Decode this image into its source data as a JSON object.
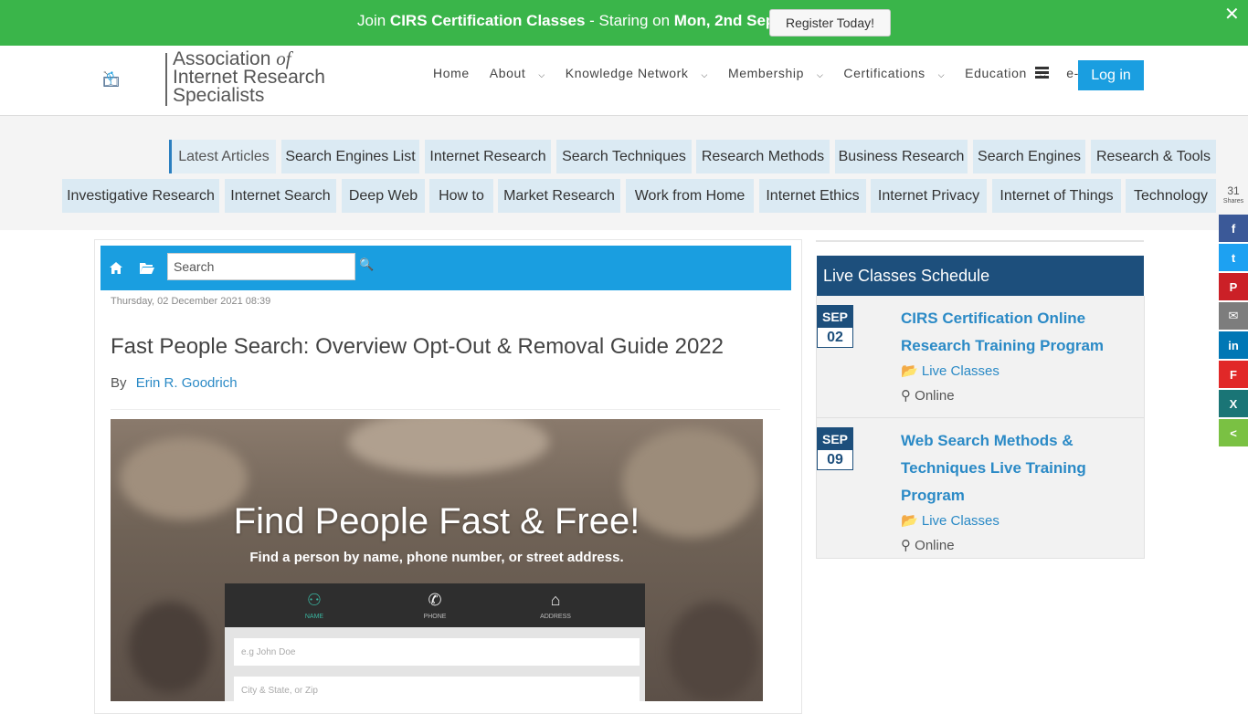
{
  "promo": {
    "prefix": "Join",
    "course": "CIRS Certification Classes",
    "mid": " - Staring on",
    "date": "Mon, 2nd Sept",
    "button": "Register Today!",
    "close": "✕"
  },
  "brand": {
    "line1a": "Association",
    "line1b": "of",
    "line2": "Internet Research",
    "line3": "Specialists"
  },
  "nav": {
    "items": [
      "Home",
      "About",
      "Knowledge Network",
      "Membership",
      "Certifications",
      "Education",
      "e-Shop"
    ],
    "dropdown_flags": [
      false,
      true,
      true,
      true,
      true,
      true,
      false
    ],
    "login": "Log in"
  },
  "tags": {
    "row1": [
      "Latest Articles",
      "Search Engines List",
      "Internet Research",
      "Search Techniques",
      "Research Methods",
      "Business Research",
      "Search Engines",
      "Research & Tools"
    ],
    "row2": [
      "Investigative Research",
      "Internet Search",
      "Deep Web",
      "How to",
      "Market Research",
      "Work from Home",
      "Internet Ethics",
      "Internet Privacy",
      "Internet of Things",
      "Technology"
    ]
  },
  "share": {
    "count": "31",
    "label": "Shares",
    "buttons": [
      {
        "icon": "facebook-icon",
        "glyph": "f",
        "color": "#3b5998"
      },
      {
        "icon": "twitter-icon",
        "glyph": "t",
        "color": "#1da1f2"
      },
      {
        "icon": "pinterest-icon",
        "glyph": "P",
        "color": "#cb2027"
      },
      {
        "icon": "email-icon",
        "glyph": "✉",
        "color": "#7d7d7d"
      },
      {
        "icon": "linkedin-icon",
        "glyph": "in",
        "color": "#0077b5"
      },
      {
        "icon": "flipboard-icon",
        "glyph": "F",
        "color": "#e12828"
      },
      {
        "icon": "xing-icon",
        "glyph": "X",
        "color": "#1a7576"
      },
      {
        "icon": "share-icon",
        "glyph": "<",
        "color": "#7ac143"
      }
    ]
  },
  "article": {
    "search_placeholder": "Search",
    "date": "Thursday, 02 December 2021 08:39",
    "title": "Fast People Search: Overview Opt-Out & Removal Guide 2022",
    "by": "By",
    "author": "Erin R. Goodrich",
    "hero": {
      "headline": "Find People Fast & Free!",
      "subline": "Find a person by name, phone number, or street address.",
      "tabs": [
        "NAME",
        "PHONE",
        "ADDRESS"
      ],
      "field1": "e.g John Doe",
      "field2": "City & State, or Zip"
    }
  },
  "sidebar": {
    "title": "Live Classes Schedule",
    "events": [
      {
        "month": "SEP",
        "day": "02",
        "title": "CIRS Certification Online Research Training Program",
        "category": "Live Classes",
        "location": "Online"
      },
      {
        "month": "SEP",
        "day": "09",
        "title": "Web Search Methods & Techniques Live Training Program",
        "category": "Live Classes",
        "location": "Online"
      }
    ]
  }
}
